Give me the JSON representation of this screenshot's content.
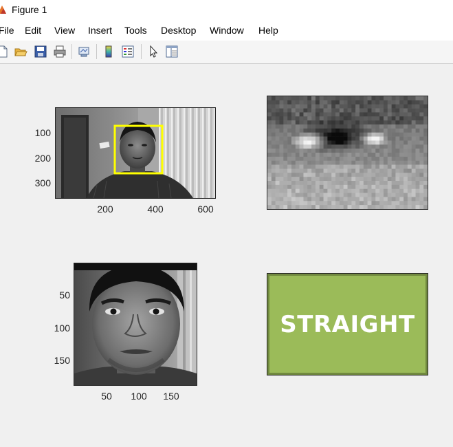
{
  "window": {
    "title": "Figure 1"
  },
  "menubar": {
    "items": [
      "File",
      "Edit",
      "View",
      "Insert",
      "Tools",
      "Desktop",
      "Window",
      "Help"
    ]
  },
  "toolbar": {
    "icons": [
      "new-figure-icon",
      "open-file-icon",
      "save-icon",
      "print-icon",
      "link-plot-icon",
      "colorbar-icon",
      "legend-icon",
      "pointer-icon",
      "property-editor-icon"
    ]
  },
  "plots": {
    "webcam": {
      "y_ticks": [
        "100",
        "200",
        "300"
      ],
      "x_ticks": [
        "200",
        "400",
        "600"
      ],
      "detection_box_color": "#ffff00"
    },
    "face": {
      "y_ticks": [
        "50",
        "100",
        "150"
      ],
      "x_ticks": [
        "50",
        "100",
        "150"
      ]
    },
    "eyes": {},
    "status": {
      "text": "STRAIGHT",
      "fill_color": "#9bbb59",
      "border_color": "#71893f"
    }
  }
}
